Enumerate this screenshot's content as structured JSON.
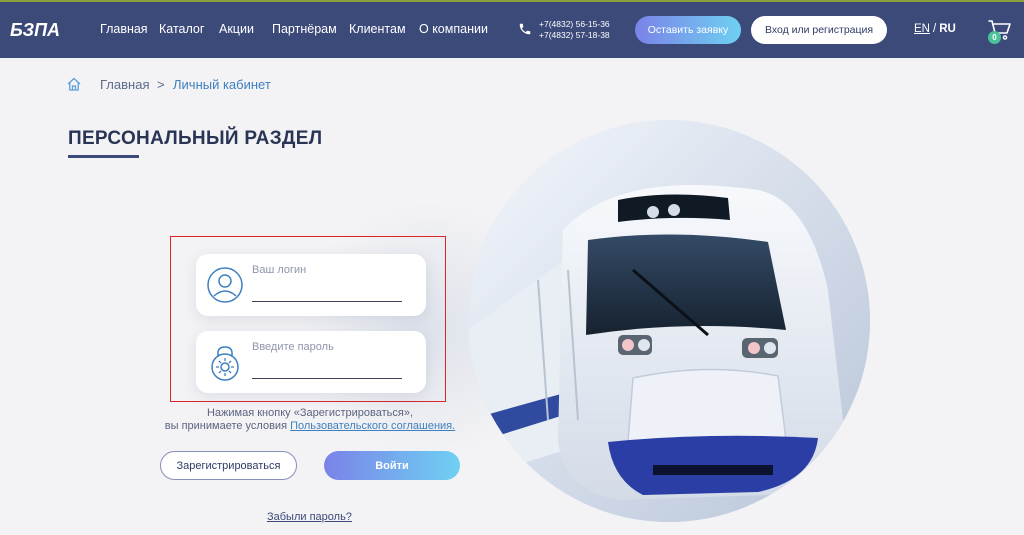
{
  "header": {
    "logo_text": "БЗПА",
    "nav": [
      "Главная",
      "Каталог",
      "Акции",
      "Партнёрам",
      "Клиентам",
      "О компании"
    ],
    "phones": [
      "+7(4832) 56-15-36",
      "+7(4832) 57-18-38"
    ],
    "request_button": "Оставить заявку",
    "login_button": "Вход или регистрация",
    "lang_en": "EN",
    "lang_sep": "/",
    "lang_ru": "RU",
    "cart_count": "0"
  },
  "breadcrumb": {
    "home": "Главная",
    "separator": ">",
    "current": "Личный кабинет"
  },
  "page_title": "ПЕРСОНАЛЬНЫЙ РАЗДЕЛ",
  "form": {
    "login_label": "Ваш логин",
    "login_value": "",
    "password_label": "Введите пароль",
    "password_value": ""
  },
  "terms": {
    "line1": "Нажимая кнопку «Зарегистрироваться»,",
    "line2_prefix": "вы принимаете условия ",
    "link": "Пользовательского соглашения."
  },
  "buttons": {
    "register": "Зарегистрироваться",
    "signin": "Войти",
    "forgot": "Забыли пароль?"
  },
  "colors": {
    "header_bg": "#3c4a7a",
    "accent_gradient_start": "#7a83e8",
    "accent_gradient_end": "#6fd0f2",
    "highlight_border": "#d9262c",
    "link": "#3f7fbf"
  }
}
